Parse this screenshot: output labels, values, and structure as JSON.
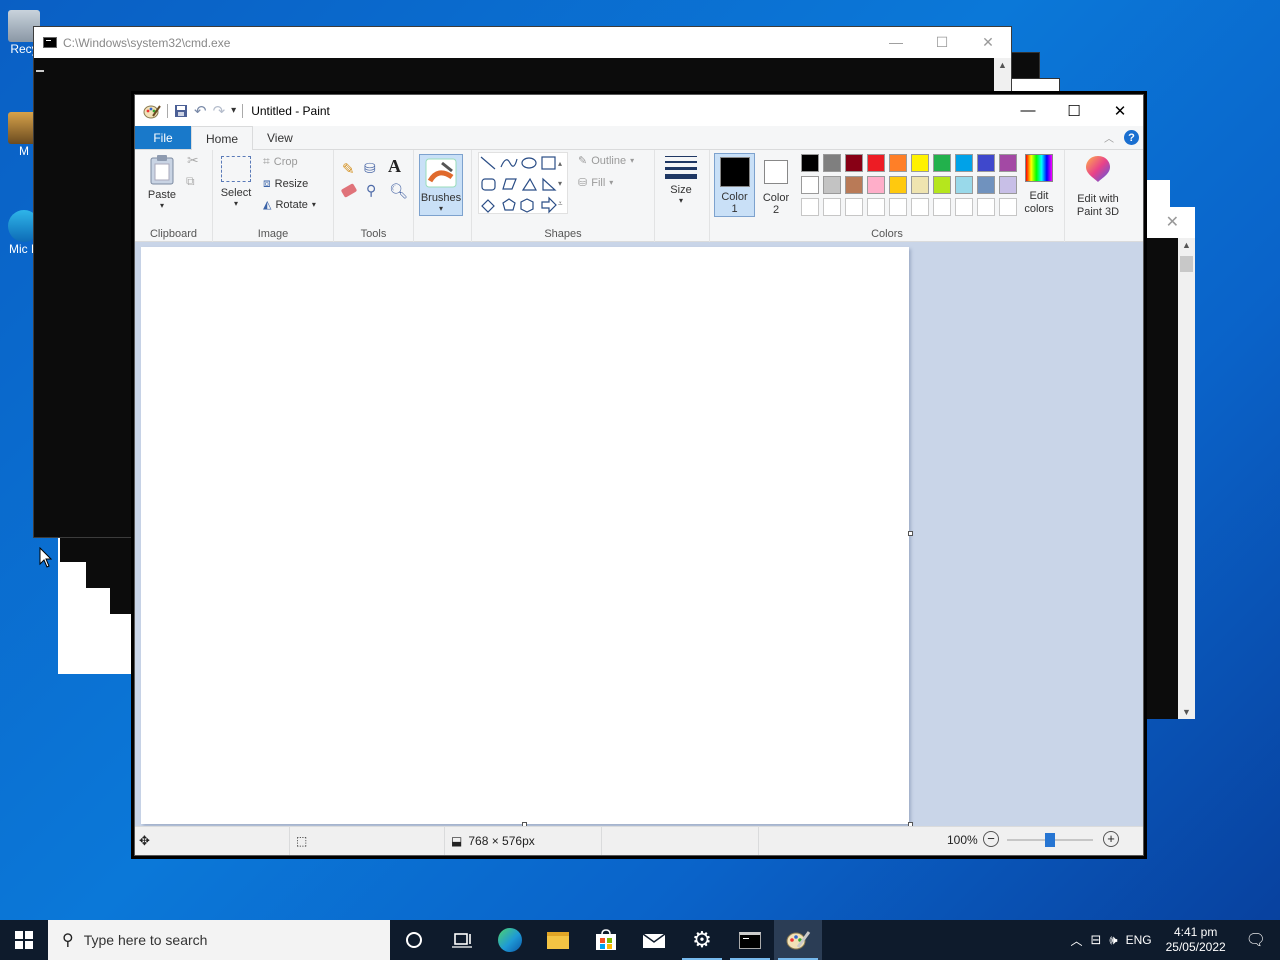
{
  "desktop": {
    "icons": [
      {
        "label": "Recy"
      },
      {
        "label": "M"
      },
      {
        "label": "Mic E"
      }
    ]
  },
  "cmd": {
    "title": "C:\\Windows\\system32\\cmd.exe"
  },
  "paint": {
    "title": "Untitled - Paint",
    "menu": {
      "file": "File",
      "home": "Home",
      "view": "View"
    },
    "clipboard": {
      "paste": "Paste",
      "label": "Clipboard"
    },
    "image": {
      "select": "Select",
      "crop": "Crop",
      "resize": "Resize",
      "rotate": "Rotate",
      "label": "Image"
    },
    "tools": {
      "label": "Tools",
      "text_glyph": "A"
    },
    "brushes": {
      "label": "Brushes"
    },
    "shapes": {
      "outline": "Outline",
      "fill": "Fill",
      "label": "Shapes"
    },
    "size": {
      "label": "Size"
    },
    "color1": {
      "label": "Color",
      "num": "1",
      "value": "#000000"
    },
    "color2": {
      "label": "Color",
      "num": "2",
      "value": "#ffffff"
    },
    "colors": {
      "label": "Colors",
      "row1": [
        "#000000",
        "#7f7f7f",
        "#880015",
        "#ed1c24",
        "#ff7f27",
        "#fff200",
        "#22b14c",
        "#00a2e8",
        "#3f48cc",
        "#a349a4"
      ],
      "row2": [
        "#ffffff",
        "#c3c3c3",
        "#b97a57",
        "#ffaec9",
        "#ffc90e",
        "#efe4b0",
        "#b5e61d",
        "#99d9ea",
        "#7092be",
        "#c8bfe7"
      ],
      "row3": [
        "#ffffff",
        "#ffffff",
        "#ffffff",
        "#ffffff",
        "#ffffff",
        "#ffffff",
        "#ffffff",
        "#ffffff",
        "#ffffff",
        "#ffffff"
      ]
    },
    "edit_colors": {
      "line1": "Edit",
      "line2": "colors"
    },
    "paint3d": {
      "line1": "Edit with",
      "line2": "Paint 3D"
    },
    "status": {
      "dimensions": "768 × 576px",
      "zoom": "100%",
      "zoom_level": 0.5
    }
  },
  "taskbar": {
    "search_placeholder": "Type here to search",
    "lang": "ENG",
    "time": "4:41 pm",
    "date": "25/05/2022"
  }
}
